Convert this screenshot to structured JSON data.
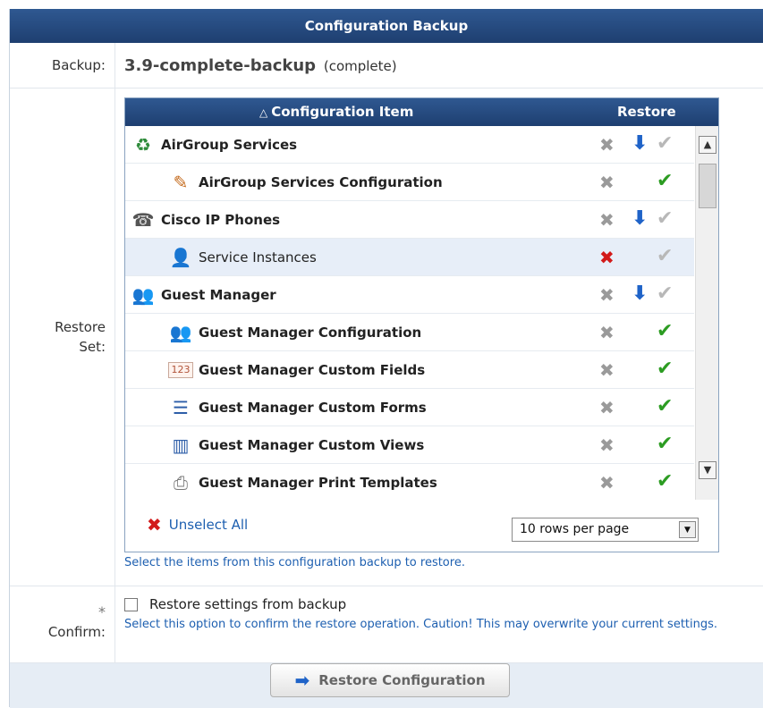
{
  "header": {
    "title": "Configuration Backup"
  },
  "backup": {
    "label": "Backup:",
    "name": "3.9-complete-backup",
    "status": "(complete)"
  },
  "restore_set": {
    "label_line1": "Restore",
    "label_line2": "Set:",
    "columns": {
      "item": "Configuration Item",
      "restore": "Restore",
      "sort_icon": "triangle-up-icon"
    },
    "rows": [
      {
        "label": "AirGroup Services",
        "icon": "airgroup-icon",
        "indent": false,
        "bold": true,
        "x": "gray",
        "down": true,
        "check": "gray",
        "selected": false
      },
      {
        "label": "AirGroup Services Configuration",
        "icon": "config-edit-icon",
        "indent": true,
        "bold": true,
        "x": "gray",
        "down": false,
        "check": "green",
        "selected": false
      },
      {
        "label": "Cisco IP Phones",
        "icon": "phone-icon",
        "indent": false,
        "bold": true,
        "x": "gray",
        "down": true,
        "check": "gray",
        "selected": false
      },
      {
        "label": "Service Instances",
        "icon": "service-user-icon",
        "indent": true,
        "bold": false,
        "x": "red",
        "down": false,
        "check": "gray",
        "selected": true
      },
      {
        "label": "Guest Manager",
        "icon": "guest-manager-icon",
        "indent": false,
        "bold": true,
        "x": "gray",
        "down": true,
        "check": "gray",
        "selected": false
      },
      {
        "label": "Guest Manager Configuration",
        "icon": "guest-manager-icon",
        "indent": true,
        "bold": true,
        "x": "gray",
        "down": false,
        "check": "green",
        "selected": false
      },
      {
        "label": "Guest Manager Custom Fields",
        "icon": "number-123-icon",
        "indent": true,
        "bold": true,
        "x": "gray",
        "down": false,
        "check": "green",
        "selected": false
      },
      {
        "label": "Guest Manager Custom Forms",
        "icon": "form-list-icon",
        "indent": true,
        "bold": true,
        "x": "gray",
        "down": false,
        "check": "green",
        "selected": false
      },
      {
        "label": "Guest Manager Custom Views",
        "icon": "columns-icon",
        "indent": true,
        "bold": true,
        "x": "gray",
        "down": false,
        "check": "green",
        "selected": false
      },
      {
        "label": "Guest Manager Print Templates",
        "icon": "printer-icon",
        "indent": true,
        "bold": true,
        "x": "gray",
        "down": false,
        "check": "green",
        "selected": false
      }
    ],
    "unselect_all": "Unselect All",
    "rows_per_page": "10 rows per page",
    "help": "Select the items from this configuration backup to restore."
  },
  "confirm": {
    "required_mark": "*",
    "label": "Confirm:",
    "checkbox_label": "Restore settings from backup",
    "help": "Select this option to confirm the restore operation. Caution! This may overwrite your current settings."
  },
  "footer": {
    "button_label": "Restore Configuration"
  },
  "colors": {
    "header": "#1e3f70",
    "link": "#1d5fb0",
    "red_x": "#d21a1a",
    "green_check": "#2c9c22",
    "blue_arrow": "#1f63c8"
  }
}
